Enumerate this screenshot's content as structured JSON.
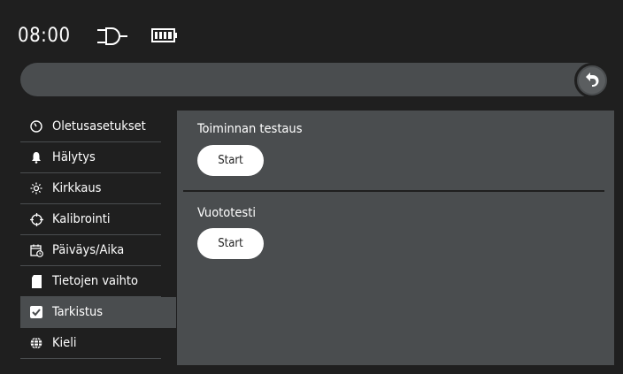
{
  "status": {
    "time": "08:00"
  },
  "sidebar": {
    "items": [
      {
        "label": "Oletusasetukset",
        "icon": "dial-icon"
      },
      {
        "label": "Hälytys",
        "icon": "bell-icon"
      },
      {
        "label": "Kirkkaus",
        "icon": "sun-icon"
      },
      {
        "label": "Kalibrointi",
        "icon": "crosshair-icon"
      },
      {
        "label": "Päiväys/Aika",
        "icon": "calendar-clock-icon"
      },
      {
        "label": "Tietojen vaihto",
        "icon": "sd-card-icon"
      },
      {
        "label": "Tarkistus",
        "icon": "checkbox-icon",
        "active": true
      },
      {
        "label": "Kieli",
        "icon": "globe-icon"
      }
    ]
  },
  "main": {
    "sections": [
      {
        "title": "Toiminnan testaus",
        "button": "Start"
      },
      {
        "title": "Vuototesti",
        "button": "Start"
      }
    ]
  },
  "colors": {
    "background": "#1f1f1f",
    "panel": "#4a4d4f",
    "button": "#ffffff"
  }
}
